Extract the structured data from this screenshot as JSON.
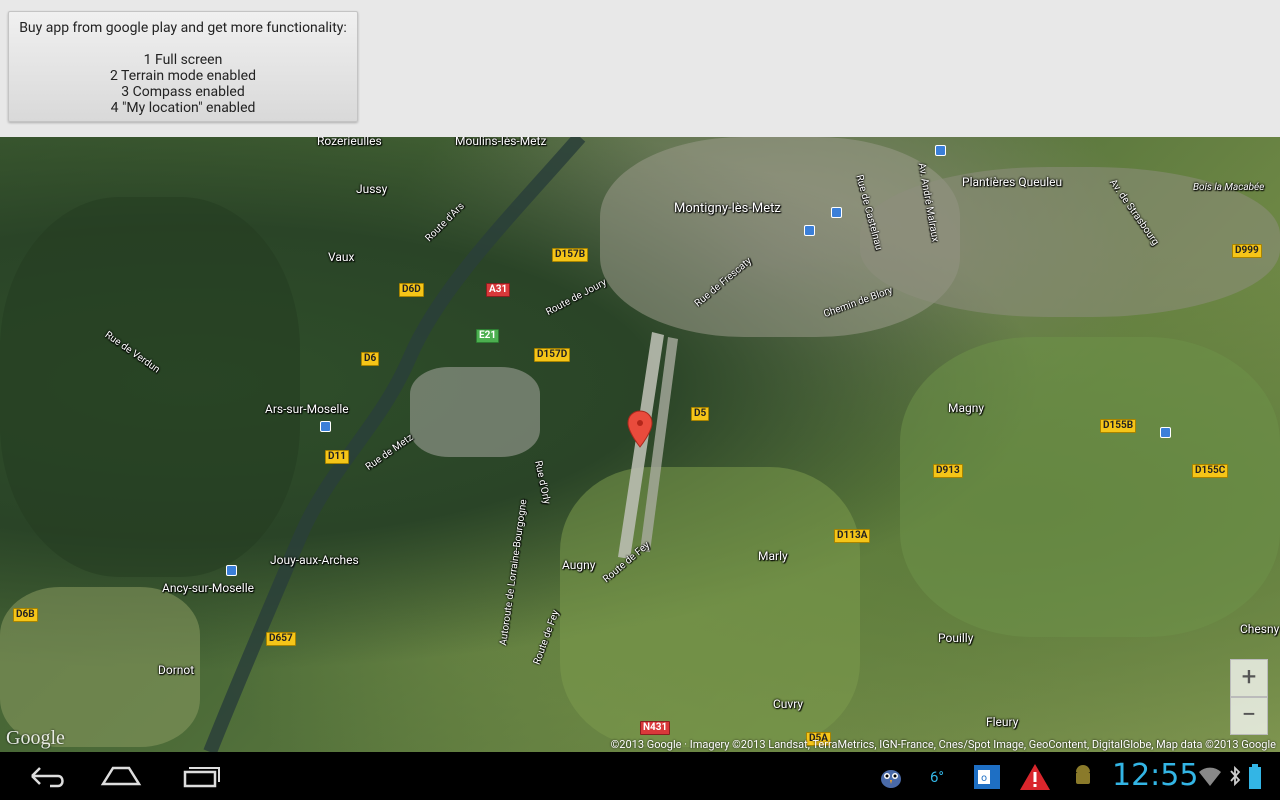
{
  "promo": {
    "heading": "Buy app from google play and get more functionality:",
    "items": [
      "1 Full screen",
      "2 Terrain mode enabled",
      "3 Compass enabled",
      "4 \"My location\" enabled"
    ]
  },
  "map": {
    "places": [
      {
        "name": "Rozerieulles"
      },
      {
        "name": "Moulins-lès-Metz"
      },
      {
        "name": "Jussy"
      },
      {
        "name": "Montigny-lès-Metz"
      },
      {
        "name": "Plantières Queuleu"
      },
      {
        "name": "Vaux"
      },
      {
        "name": "Ars-sur-Moselle"
      },
      {
        "name": "Magny"
      },
      {
        "name": "Jouy-aux-Arches"
      },
      {
        "name": "Ancy-sur-Moselle"
      },
      {
        "name": "Augny"
      },
      {
        "name": "Marly"
      },
      {
        "name": "Pouilly"
      },
      {
        "name": "Chesny"
      },
      {
        "name": "Dornot"
      },
      {
        "name": "Cuvry"
      },
      {
        "name": "Fleury"
      },
      {
        "name": "Bois la Macabée"
      }
    ],
    "streets": [
      "Route d'Ars",
      "Route de Joury",
      "Rue de Frescaty",
      "Chemin de Blory",
      "Rue de Castelnau",
      "Av. André Malraux",
      "Av. de Strasbourg",
      "Rue de Verdun",
      "Rue de Metz",
      "Rue d'Orly",
      "Autoroute de Lorraine-Bourgogne",
      "Route de Fey",
      "Route de Fey"
    ],
    "roads": {
      "d157b": "D157B",
      "d6d": "D6D",
      "a31": "A31",
      "e21": "E21",
      "d157d": "D157D",
      "d6": "D6",
      "d5": "D5",
      "d999": "D999",
      "d155b": "D155B",
      "d155c": "D155C",
      "d913": "D913",
      "d11": "D11",
      "d113a": "D113A",
      "d6b": "D6B",
      "d657": "D657",
      "n431": "N431",
      "d5a": "D5A"
    },
    "zoom_in": "+",
    "zoom_out": "−",
    "logo": "Google",
    "copyright": "©2013 Google · Imagery ©2013 Landsat, TerraMetrics, IGN-France, Cnes/Spot Image, GeoContent, DigitalGlobe, Map data ©2013 Google"
  },
  "status": {
    "temperature": "6°",
    "time": "12:55"
  }
}
